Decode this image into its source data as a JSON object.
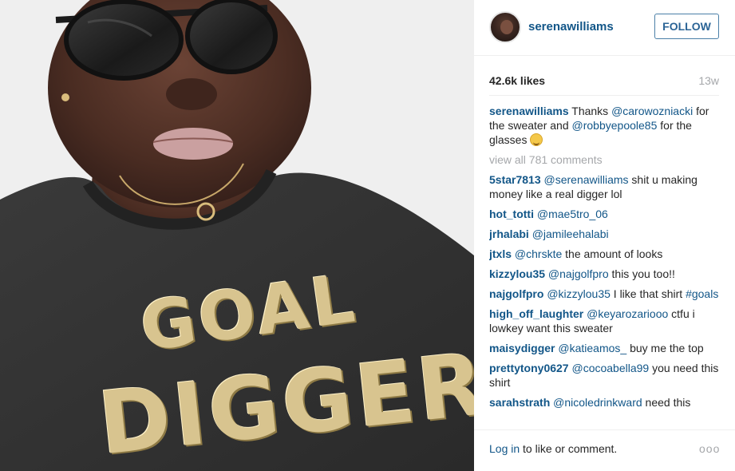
{
  "header": {
    "username": "serenawilliams",
    "follow_label": "FOLLOW"
  },
  "stats": {
    "likes": "42.6k likes",
    "age": "13w"
  },
  "photo": {
    "sweater_line1": "GOAL",
    "sweater_line2": "DIGGER"
  },
  "caption": {
    "user": "serenawilliams",
    "parts": [
      {
        "t": " Thanks "
      },
      {
        "m": "@carowozniacki"
      },
      {
        "t": " for the sweater and "
      },
      {
        "m": "@robbyepoole85"
      },
      {
        "t": " for the glasses "
      }
    ],
    "emoji": "blushing-smiley-emoji"
  },
  "view_all": "view all 781 comments",
  "comments": [
    {
      "user": "5star7813",
      "parts": [
        {
          "m": "@serenawilliams"
        },
        {
          "t": " shit u making money like a real digger lol"
        }
      ]
    },
    {
      "user": "hot_totti",
      "parts": [
        {
          "m": "@mae5tro_06"
        }
      ]
    },
    {
      "user": "jrhalabi",
      "parts": [
        {
          "m": "@jamileehalabi"
        }
      ]
    },
    {
      "user": "jtxls",
      "parts": [
        {
          "m": "@chrskte"
        },
        {
          "t": " the amount of looks"
        }
      ]
    },
    {
      "user": "kizzylou35",
      "parts": [
        {
          "m": "@najgolfpro"
        },
        {
          "t": " this you too!!"
        }
      ]
    },
    {
      "user": "najgolfpro",
      "parts": [
        {
          "m": "@kizzylou35"
        },
        {
          "t": " I like that shirt "
        },
        {
          "m": "#goals"
        }
      ]
    },
    {
      "user": "high_off_laughter",
      "parts": [
        {
          "m": "@keyarozariooo"
        },
        {
          "t": " ctfu i lowkey want this sweater"
        }
      ]
    },
    {
      "user": "maisydigger",
      "parts": [
        {
          "m": "@katieamos_"
        },
        {
          "t": " buy me the top"
        }
      ]
    },
    {
      "user": "prettytony0627",
      "parts": [
        {
          "m": "@cocoabella99"
        },
        {
          "t": " you need this shirt"
        }
      ]
    },
    {
      "user": "sarahstrath",
      "parts": [
        {
          "m": "@nicoledrinkward"
        },
        {
          "t": " need this"
        }
      ]
    }
  ],
  "footer": {
    "login_link": "Log in",
    "login_rest": " to like or comment.",
    "more_icon": "ooo"
  }
}
